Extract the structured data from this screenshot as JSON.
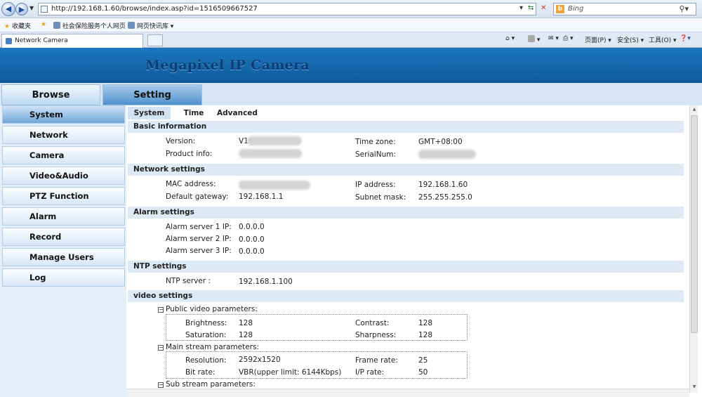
{
  "browser": {
    "url": "http://192.168.1.60/browse/index.asp?id=1516509667527",
    "search_placeholder": "Bing",
    "favorites_label": "收藏夹",
    "fav_links": [
      "社会保险服务个人网页",
      "网页快讯库 ▾"
    ],
    "tab_title": "Network Camera",
    "cmd_page": "页面(P) ▾",
    "cmd_safety": "安全(S) ▾",
    "cmd_tools": "工具(O) ▾",
    "cmd_help": "❓▾"
  },
  "banner": {
    "title": "Megapixel IP Camera"
  },
  "topnav": {
    "browse": "Browse",
    "setting": "Setting"
  },
  "sidebar": {
    "items": [
      "System",
      "Network",
      "Camera",
      "Video&Audio",
      "PTZ Function",
      "Alarm",
      "Record",
      "Manage Users",
      "Log"
    ]
  },
  "subtabs": [
    "System",
    "Time",
    "Advanced"
  ],
  "basic": {
    "title": "Basic information",
    "version_label": "Version:",
    "version_value": "V1",
    "product_label": "Product info:",
    "timezone_label": "Time zone:",
    "timezone_value": "GMT+08:00",
    "serial_label": "SerialNum:"
  },
  "network": {
    "title": "Network settings",
    "mac_label": "MAC address:",
    "gateway_label": "Default gateway:",
    "gateway_value": "192.168.1.1",
    "ip_label": "IP address:",
    "ip_value": "192.168.1.60",
    "mask_label": "Subnet mask:",
    "mask_value": "255.255.255.0"
  },
  "alarm": {
    "title": "Alarm settings",
    "s1_label": "Alarm server 1 IP:",
    "s1_value": "0.0.0.0",
    "s2_label": "Alarm server 2 IP:",
    "s2_value": "0.0.0.0",
    "s3_label": "Alarm server 3 IP:",
    "s3_value": "0.0.0.0"
  },
  "ntp": {
    "title": "NTP settings",
    "server_label": "NTP server :",
    "server_value": "192.168.1.100"
  },
  "video": {
    "title": "video settings",
    "public_title": "Public video parameters:",
    "brightness_label": "Brightness:",
    "brightness_value": "128",
    "saturation_label": "Saturation:",
    "saturation_value": "128",
    "contrast_label": "Contrast:",
    "contrast_value": "128",
    "sharpness_label": "Sharpness:",
    "sharpness_value": "128",
    "main_title": "Main stream parameters:",
    "resolution_label": "Resolution:",
    "resolution_value": "2592x1520",
    "bitrate_label": "Bit rate:",
    "bitrate_value": "VBR(upper limit: 6144Kbps)",
    "framerate_label": "Frame rate:",
    "framerate_value": "25",
    "iprate_label": "I/P rate:",
    "iprate_value": "50",
    "sub_title": "Sub stream parameters:"
  }
}
